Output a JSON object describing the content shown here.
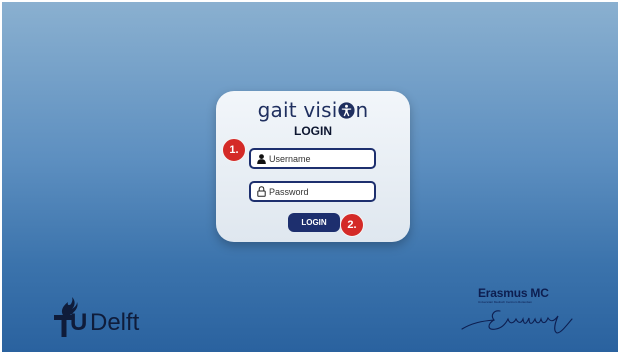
{
  "login_card": {
    "brand_prefix": "gait visi",
    "brand_suffix": "n",
    "title": "LOGIN",
    "username_placeholder": "Username",
    "password_placeholder": "Password",
    "login_button_label": "LOGIN"
  },
  "step_markers": [
    "1.",
    "2."
  ],
  "footer": {
    "tudelft_u": "U",
    "tudelft_word": "Delft",
    "erasmus_name": "Erasmus MC",
    "erasmus_tagline": "Universitair Medisch Centrum Rotterdam"
  },
  "colors": {
    "accent": "#1d2f6e",
    "marker": "#d42a27",
    "background_top": "#8ab0d0",
    "background_bottom": "#2a629f"
  }
}
